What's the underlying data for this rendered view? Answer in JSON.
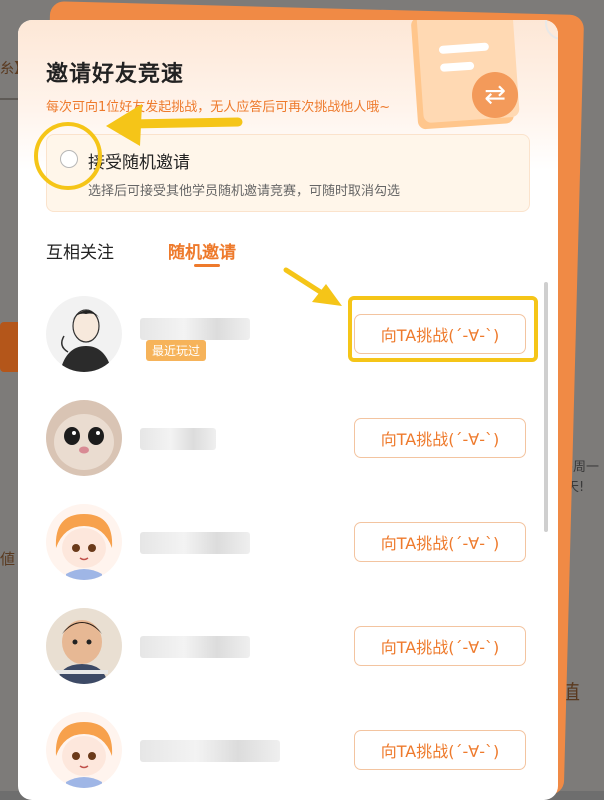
{
  "background": {
    "fragments": [
      "糸】",
      "每周一",
      "天!",
      "値",
      "值"
    ]
  },
  "dialog": {
    "title": "邀请好友竞速",
    "subtitle": "每次可向1位好友发起挑战，无人应答后可再次挑战他人哦~",
    "random_option": {
      "label": "接受随机邀请",
      "description": "选择后可接受其他学员随机邀请竞赛，可随时取消勾选",
      "checked": false
    },
    "tabs": [
      {
        "label": "互相关注",
        "active": false
      },
      {
        "label": "随机邀请",
        "active": true
      }
    ],
    "friends": [
      {
        "avatar": "man-sketch-avatar",
        "recent": "最近玩过",
        "button": "向TA挑战(´-∀-`)"
      },
      {
        "avatar": "cat-avatar",
        "recent": "",
        "button": "向TA挑战(´-∀-`)"
      },
      {
        "avatar": "anime-girl-avatar",
        "recent": "",
        "button": "向TA挑战(´-∀-`)"
      },
      {
        "avatar": "child-photo-avatar",
        "recent": "",
        "button": "向TA挑战(´-∀-`)"
      },
      {
        "avatar": "anime-girl-avatar",
        "recent": "",
        "button": "向TA挑战(´-∀-`)"
      }
    ]
  },
  "colors": {
    "accent": "#ee7a2c",
    "annotation": "#f5c518",
    "tag": "#f6b35a"
  }
}
